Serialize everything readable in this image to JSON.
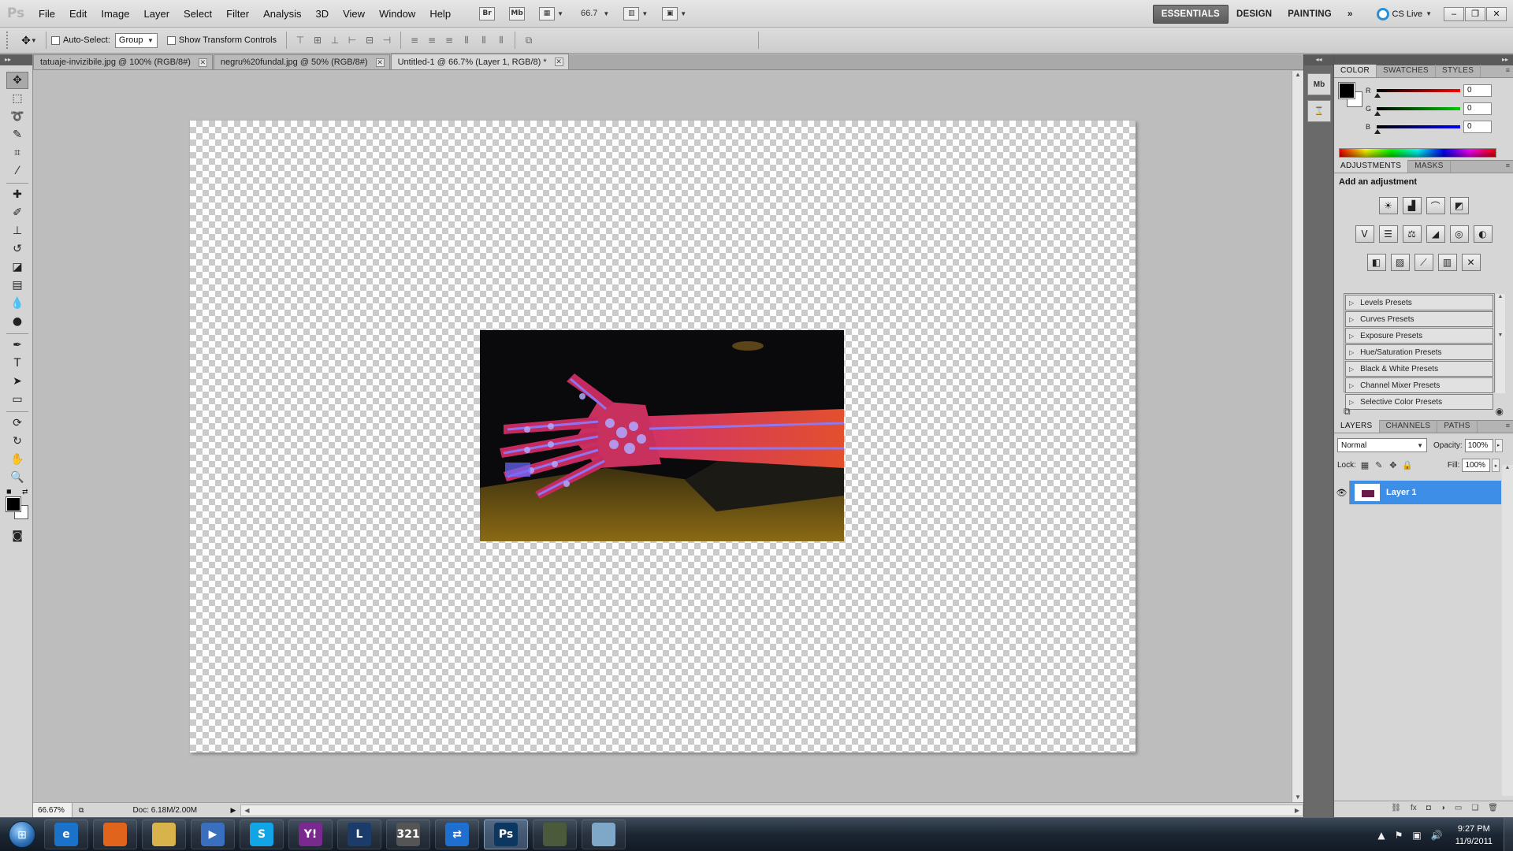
{
  "app": {
    "logo": "Ps",
    "menus": [
      "File",
      "Edit",
      "Image",
      "Layer",
      "Select",
      "Filter",
      "Analysis",
      "3D",
      "View",
      "Window",
      "Help"
    ],
    "bridge_label": "Br",
    "minibridge_label": "Mb",
    "zoom_field": "66.7",
    "workspaces": [
      "ESSENTIALS",
      "DESIGN",
      "PAINTING"
    ],
    "more_workspaces": "»",
    "cs_live": "CS Live"
  },
  "options": {
    "auto_select_label": "Auto-Select:",
    "auto_select_value": "Group",
    "show_transform_label": "Show Transform Controls"
  },
  "tabs": [
    {
      "label": "tatuaje-invizibile.jpg @ 100% (RGB/8#)"
    },
    {
      "label": "negru%20fundal.jpg @ 50% (RGB/8#)"
    },
    {
      "label": "Untitled-1 @ 66.7% (Layer 1, RGB/8) *"
    }
  ],
  "status": {
    "zoom": "66.67%",
    "doc": "Doc: 6.18M/2.00M"
  },
  "strip": {
    "mini_bridge": "Mb"
  },
  "color_panel": {
    "tabs": [
      "COLOR",
      "SWATCHES",
      "STYLES"
    ],
    "channels": [
      {
        "label": "R",
        "value": "0",
        "color": "#e02020"
      },
      {
        "label": "G",
        "value": "0",
        "color": "#20b020"
      },
      {
        "label": "B",
        "value": "0",
        "color": "#2030e0"
      }
    ],
    "foreground": "#000000",
    "background": "#ffffff"
  },
  "adjustments": {
    "tabs": [
      "ADJUSTMENTS",
      "MASKS"
    ],
    "title": "Add an adjustment",
    "presets": [
      "Levels Presets",
      "Curves Presets",
      "Exposure Presets",
      "Hue/Saturation Presets",
      "Black & White Presets",
      "Channel Mixer Presets",
      "Selective Color Presets"
    ]
  },
  "layers": {
    "tabs": [
      "LAYERS",
      "CHANNELS",
      "PATHS"
    ],
    "blend_mode": "Normal",
    "opacity_label": "Opacity:",
    "opacity": "100%",
    "lock_label": "Lock:",
    "fill_label": "Fill:",
    "fill": "100%",
    "items": [
      {
        "name": "Layer 1",
        "selected": true
      }
    ],
    "selection_color": "#3d8ee6"
  },
  "taskbar": {
    "apps": [
      {
        "name": "ie",
        "label": "e",
        "color": "#1a73c9"
      },
      {
        "name": "firefox",
        "label": "",
        "color": "#e0641c"
      },
      {
        "name": "explorer",
        "label": "",
        "color": "#d8b24a"
      },
      {
        "name": "media-player",
        "label": "▶",
        "color": "#3a6fc0"
      },
      {
        "name": "skype",
        "label": "S",
        "color": "#12a5e6"
      },
      {
        "name": "yahoo-messenger",
        "label": "Y!",
        "color": "#7a2a8e"
      },
      {
        "name": "league-of-legends",
        "label": "L",
        "color": "#1b3b6b"
      },
      {
        "name": "321-player",
        "label": "321",
        "color": "#555555"
      },
      {
        "name": "teamviewer",
        "label": "⇄",
        "color": "#1e6fd0"
      },
      {
        "name": "photoshop",
        "label": "Ps",
        "color": "#0b3760",
        "active": true
      },
      {
        "name": "game",
        "label": "",
        "color": "#4a5a3a"
      },
      {
        "name": "notes",
        "label": "",
        "color": "#7fa8c8"
      }
    ],
    "time": "9:27 PM",
    "date": "11/9/2011"
  }
}
